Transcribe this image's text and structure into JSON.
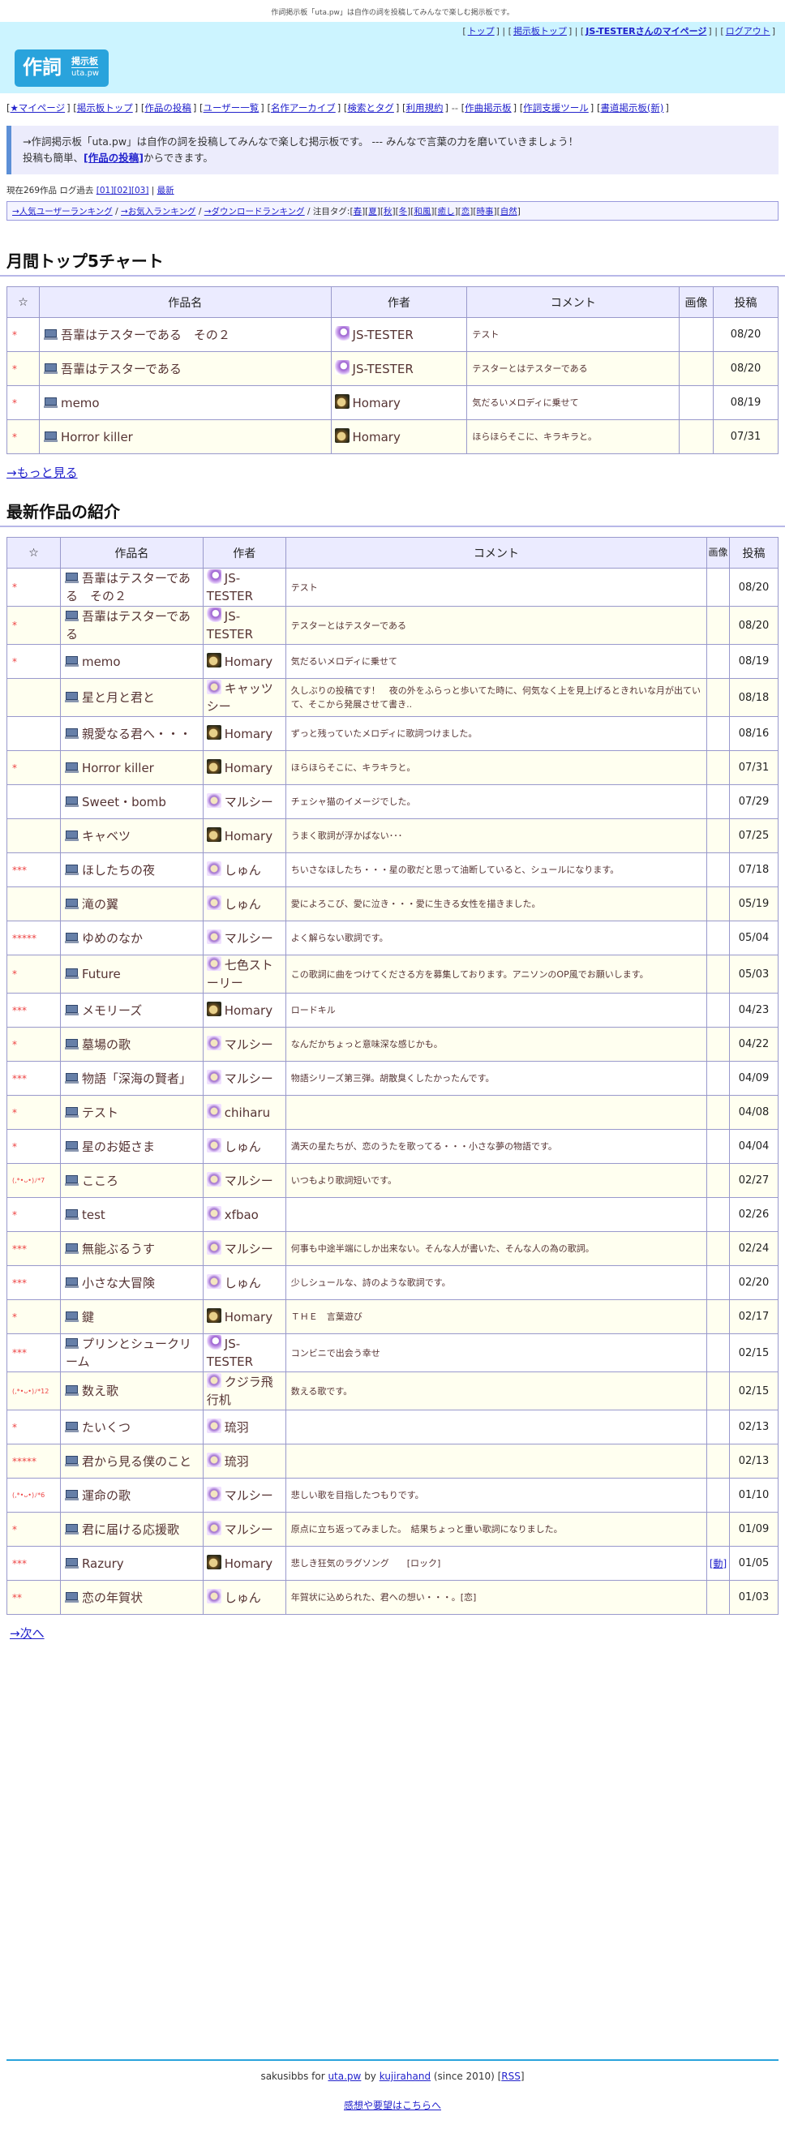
{
  "topnote": "作詞掲示板「uta.pw」は自作の詞を投稿してみんなで楽しむ掲示板です。",
  "header_links": [
    "トップ",
    "掲示板トップ",
    "JS-TESTERさんのマイページ",
    "ログアウト"
  ],
  "logo": {
    "big": "作詞",
    "small1": "掲示板",
    "small2": "uta.pw"
  },
  "main_nav": [
    "★マイページ",
    "掲示板トップ",
    "作品の投稿",
    "ユーザー一覧",
    "名作アーカイブ",
    "検索とタグ",
    "利用規約",
    "作曲掲示板",
    "作詞支援ツール",
    "書道掲示板(新)"
  ],
  "nav_dashes": "--",
  "intro": {
    "line1": "→作詞掲示板「uta.pw」は自作の詞を投稿してみんなで楽しむ掲示板です。 --- みんなで言葉の力を磨いていきましょう！",
    "line2_pre": "投稿も簡単、",
    "line2_link": "[作品の投稿]",
    "line2_post": "からできます。"
  },
  "stats": {
    "prefix": "現在269作品 ログ過去",
    "links": [
      "[01]",
      "[02]",
      "[03]"
    ],
    "sep": " | ",
    "latest": "最新"
  },
  "rankbar": {
    "links": [
      "→人気ユーザーランキング",
      "→お気入ランキング",
      "→ダウンロードランキング"
    ],
    "tag_label": "注目タグ:",
    "tags": [
      "春",
      "夏",
      "秋",
      "冬",
      "和風",
      "癒し",
      "恋",
      "時事",
      "自然"
    ]
  },
  "section1_title": "月間トップ5チャート",
  "section2_title": "最新作品の紹介",
  "table_headers": {
    "star": "☆",
    "title": "作品名",
    "author": "作者",
    "comment": "コメント",
    "image": "画像",
    "image_short": "画像",
    "date": "投稿"
  },
  "top_chart": [
    {
      "star": "*",
      "title": "吾輩はテスターである　その２",
      "author": "JS-TESTER",
      "avatar": "js",
      "comment": "テスト",
      "image": "",
      "date": "08/20"
    },
    {
      "star": "*",
      "title": "吾輩はテスターである",
      "author": "JS-TESTER",
      "avatar": "js",
      "comment": "テスターとはテスターである",
      "image": "",
      "date": "08/20"
    },
    {
      "star": "*",
      "title": "memo",
      "author": "Homary",
      "avatar": "hom",
      "comment": "気だるいメロディに乗せて",
      "image": "",
      "date": "08/19"
    },
    {
      "star": "*",
      "title": "Horror killer",
      "author": "Homary",
      "avatar": "hom",
      "comment": "ほらほらそこに、キラキラと。",
      "image": "",
      "date": "07/31"
    }
  ],
  "more_link": "→もっと見る",
  "latest": [
    {
      "star": "*",
      "title": "吾輩はテスターである　その２",
      "author": "JS-TESTER",
      "avatar": "js",
      "comment": "テスト",
      "image": "",
      "date": "08/20",
      "tall": false
    },
    {
      "star": "*",
      "title": "吾輩はテスターである",
      "author": "JS-TESTER",
      "avatar": "js",
      "comment": "テスターとはテスターである",
      "image": "",
      "date": "08/20",
      "tall": false
    },
    {
      "star": "*",
      "title": "memo",
      "author": "Homary",
      "avatar": "hom",
      "comment": "気だるいメロディに乗せて",
      "image": "",
      "date": "08/19",
      "tall": false
    },
    {
      "star": "",
      "title": "星と月と君と",
      "author": "キャッツシー",
      "avatar": "other",
      "comment": "久しぶりの投稿です！　夜の外をふらっと歩いてた時に、何気なく上を見上げるときれいな月が出ていて、そこから発展させて書き..",
      "image": "",
      "date": "08/18",
      "tall": false
    },
    {
      "star": "",
      "title": "親愛なる君へ・・・",
      "author": "Homary",
      "avatar": "hom",
      "comment": "ずっと残っていたメロディに歌詞つけました。",
      "image": "",
      "date": "08/16",
      "tall": false
    },
    {
      "star": "*",
      "title": "Horror killer",
      "author": "Homary",
      "avatar": "hom",
      "comment": "ほらほらそこに、キラキラと。",
      "image": "",
      "date": "07/31",
      "tall": false
    },
    {
      "star": "",
      "title": "Sweet・bomb",
      "author": "マルシー",
      "avatar": "other",
      "comment": "チェシャ猫のイメージでした。",
      "image": "",
      "date": "07/29",
      "tall": false
    },
    {
      "star": "",
      "title": "キャベツ",
      "author": "Homary",
      "avatar": "hom",
      "comment": "うまく歌詞が浮かばない･･･",
      "image": "",
      "date": "07/25",
      "tall": false
    },
    {
      "star": "***",
      "title": "ほしたちの夜",
      "author": "しゅん",
      "avatar": "other",
      "comment": "ちいさなほしたち・・・星の歌だと思って油断していると、シュールになります。",
      "image": "",
      "date": "07/18",
      "tall": false
    },
    {
      "star": "",
      "title": "滝の翼",
      "author": "しゅん",
      "avatar": "other",
      "comment": "愛によろこび、愛に泣き・・・愛に生きる女性を描きました。",
      "image": "",
      "date": "05/19",
      "tall": false
    },
    {
      "star": "*****",
      "title": "ゆめのなか",
      "author": "マルシー",
      "avatar": "other",
      "comment": "よく解らない歌詞です。",
      "image": "",
      "date": "05/04",
      "tall": false
    },
    {
      "star": "*",
      "title": "Future",
      "author": "七色ストーリー",
      "avatar": "other",
      "comment": "この歌詞に曲をつけてくださる方を募集しております。アニソンのOP風でお願いします。",
      "image": "",
      "date": "05/03",
      "tall": false
    },
    {
      "star": "***",
      "title": "メモリーズ",
      "author": "Homary",
      "avatar": "hom",
      "comment": "ロードキル",
      "image": "",
      "date": "04/23",
      "tall": false
    },
    {
      "star": "*",
      "title": "墓場の歌",
      "author": "マルシー",
      "avatar": "other",
      "comment": "なんだかちょっと意味深な感じかも。",
      "image": "",
      "date": "04/22",
      "tall": false
    },
    {
      "star": "***",
      "title": "物語「深海の賢者」",
      "author": "マルシー",
      "avatar": "other",
      "comment": "物語シリーズ第三弾。胡散臭くしたかったんです。",
      "image": "",
      "date": "04/09",
      "tall": false
    },
    {
      "star": "*",
      "title": "テスト",
      "author": "chiharu",
      "avatar": "other",
      "comment": "",
      "image": "",
      "date": "04/08",
      "tall": false
    },
    {
      "star": "*",
      "title": "星のお姫さま",
      "author": "しゅん",
      "avatar": "other",
      "comment": "満天の星たちが、恋のうたを歌ってる・・・小さな夢の物語です。",
      "image": "",
      "date": "04/04",
      "tall": false
    },
    {
      "star": "(,*•ᴗ•)ﾉ*7",
      "title": "こころ",
      "author": "マルシー",
      "avatar": "other",
      "comment": "いつもより歌詞短いです。",
      "image": "",
      "date": "02/27",
      "tall": false
    },
    {
      "star": "*",
      "title": "test",
      "author": "xfbao",
      "avatar": "other",
      "comment": "",
      "image": "",
      "date": "02/26",
      "tall": false
    },
    {
      "star": "***",
      "title": "無能ぶるうす",
      "author": "マルシー",
      "avatar": "other",
      "comment": "何事も中途半端にしか出来ない。そんな人が書いた、そんな人の為の歌詞。",
      "image": "",
      "date": "02/24",
      "tall": false
    },
    {
      "star": "***",
      "title": "小さな大冒険",
      "author": "しゅん",
      "avatar": "other",
      "comment": "少しシュールな、詩のような歌詞です。",
      "image": "",
      "date": "02/20",
      "tall": false
    },
    {
      "star": "*",
      "title": "鍵",
      "author": "Homary",
      "avatar": "hom",
      "comment": "ＴＨＥ　言葉遊び",
      "image": "",
      "date": "02/17",
      "tall": false
    },
    {
      "star": "***",
      "title": "プリンとシュークリーム",
      "author": "JS-TESTER",
      "avatar": "js",
      "comment": "コンビニで出会う幸せ",
      "image": "",
      "date": "02/15",
      "tall": false
    },
    {
      "star": "(,*•ᴗ•)ﾉ*12",
      "title": "数え歌",
      "author": "クジラ飛行机",
      "avatar": "other",
      "comment": "数える歌です。",
      "image": "",
      "date": "02/15",
      "tall": false
    },
    {
      "star": "*",
      "title": "たいくつ",
      "author": "琉羽",
      "avatar": "other",
      "comment": "",
      "image": "",
      "date": "02/13",
      "tall": false
    },
    {
      "star": "*****",
      "title": "君から見る僕のこと",
      "author": "琉羽",
      "avatar": "other",
      "comment": "",
      "image": "",
      "date": "02/13",
      "tall": false
    },
    {
      "star": "(,*•ᴗ•)ﾉ*6",
      "title": "運命の歌",
      "author": "マルシー",
      "avatar": "other",
      "comment": "悲しい歌を目指したつもりです。",
      "image": "",
      "date": "01/10",
      "tall": false
    },
    {
      "star": "*",
      "title": "君に届ける応援歌",
      "author": "マルシー",
      "avatar": "other",
      "comment": "原点に立ち返ってみました。　結果ちょっと重い歌詞になりました。",
      "image": "",
      "date": "01/09",
      "tall": false
    },
    {
      "star": "***",
      "title": "Razury",
      "author": "Homary",
      "avatar": "hom",
      "comment": "悲しき狂気のラグソング　　[ロック]",
      "image": "[動]",
      "date": "01/05",
      "tall": false
    },
    {
      "star": "**",
      "title": "恋の年賀状",
      "author": "しゅん",
      "avatar": "other",
      "comment": "年賀状に込められた、君への想い・・・。[恋]",
      "image": "",
      "date": "01/03",
      "tall": false
    }
  ],
  "next_link": "→次へ",
  "footer": {
    "pre": "sakusibbs for ",
    "site": "uta.pw",
    "by": " by ",
    "author": "kujirahand",
    "since": " (since 2010) [",
    "rss": "RSS",
    "close": "]",
    "feedback": "感想や要望はこちらへ"
  }
}
